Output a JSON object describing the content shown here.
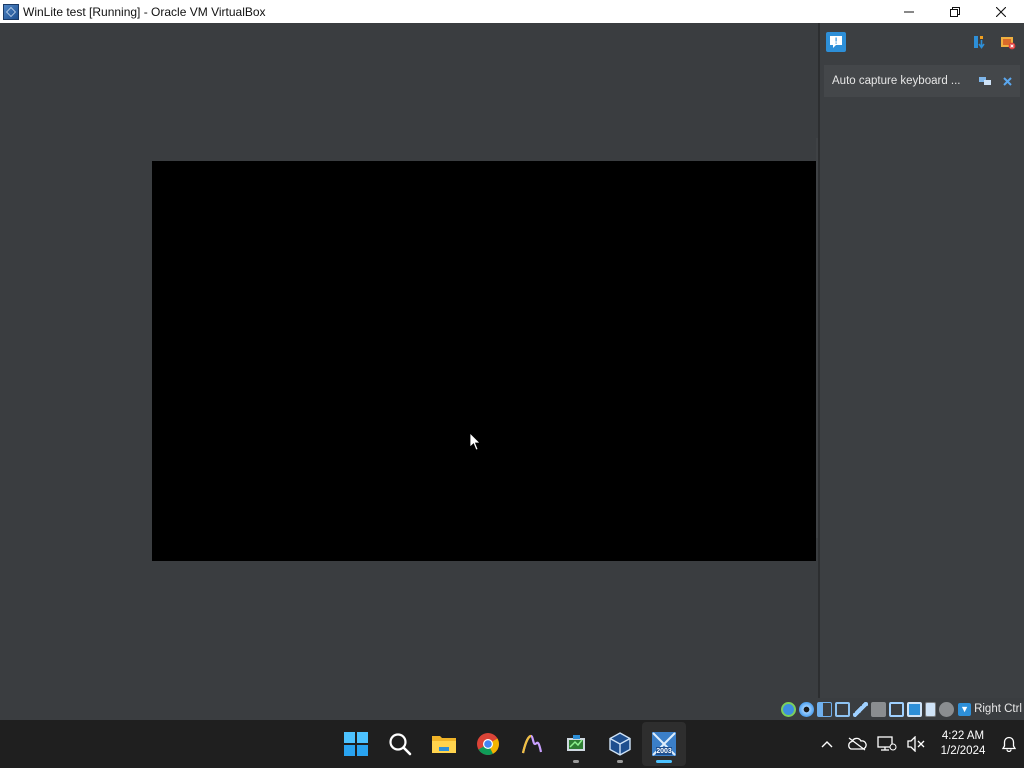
{
  "window": {
    "title": "WinLite test [Running] - Oracle VM VirtualBox"
  },
  "notification_panel": {
    "notice_text": "Auto capture keyboard ..."
  },
  "statusbar": {
    "host_key": "Right Ctrl"
  },
  "taskbar": {
    "apps": [
      {
        "name": "start-button",
        "icon": "windows-logo-icon"
      },
      {
        "name": "search-button",
        "icon": "search-icon"
      },
      {
        "name": "file-explorer-button",
        "icon": "folder-icon"
      },
      {
        "name": "chrome-button",
        "icon": "chrome-icon"
      },
      {
        "name": "app-button",
        "icon": "app-icon"
      },
      {
        "name": "virtualbox-manager-button",
        "icon": "virtualbox-manager-icon"
      },
      {
        "name": "virtualbox-button",
        "icon": "virtualbox-icon"
      },
      {
        "name": "vm-window-button",
        "icon": "vm-icon",
        "label": "2003"
      }
    ],
    "clock_time": "4:22 AM",
    "clock_date": "1/2/2024"
  },
  "colors": {
    "accent": "#2d8fd8",
    "vm_background": "#3a3d40",
    "taskbar": "#1f1f1f"
  }
}
